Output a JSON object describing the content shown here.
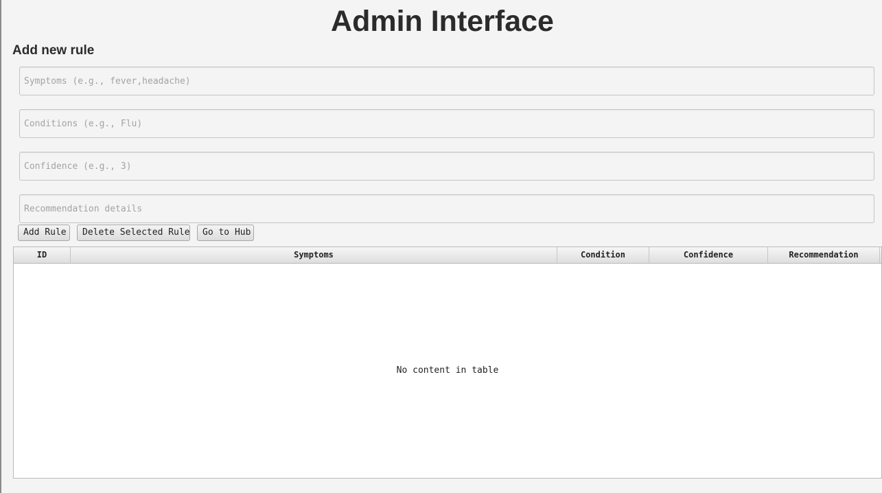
{
  "header": {
    "title": "Admin Interface"
  },
  "form": {
    "section_title": "Add new rule",
    "symptoms": {
      "value": "",
      "placeholder": "Symptoms (e.g., fever,headache)"
    },
    "conditions": {
      "value": "",
      "placeholder": "Conditions (e.g., Flu)"
    },
    "confidence": {
      "value": "",
      "placeholder": "Confidence (e.g., 3)"
    },
    "recommendation": {
      "value": "",
      "placeholder": "Recommendation details"
    }
  },
  "buttons": {
    "add": "Add Rule",
    "delete": "Delete Selected Rule",
    "hub": "Go to Hub"
  },
  "table": {
    "columns": [
      "ID",
      "Symptoms",
      "Condition",
      "Confidence",
      "Recommendation"
    ],
    "rows": [],
    "empty_message": "No content in table"
  }
}
